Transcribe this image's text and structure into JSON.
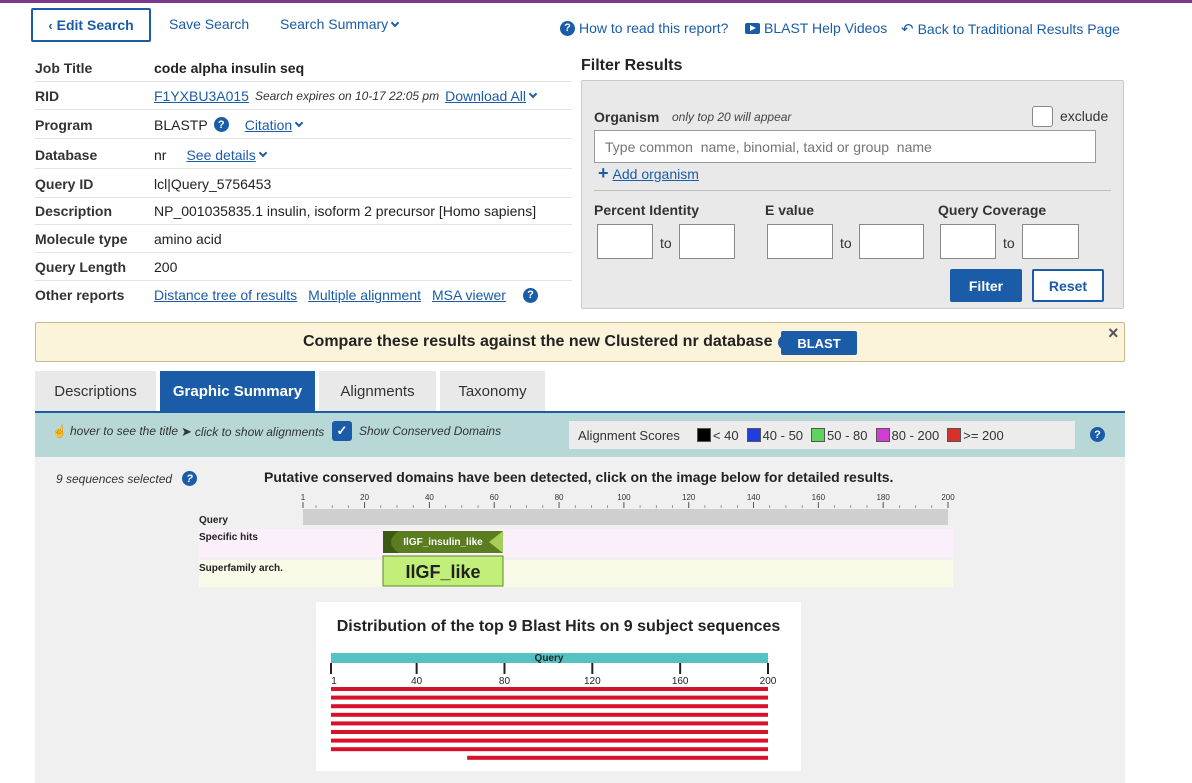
{
  "topbar": {
    "edit_search": "Edit Search",
    "save_search": "Save Search",
    "search_summary": "Search Summary",
    "how_to_read": "How to read this report?",
    "help_videos": "BLAST Help Videos",
    "back_link": "Back to Traditional Results Page"
  },
  "job": {
    "rows": [
      {
        "label": "Job Title",
        "value": "code alpha insulin seq"
      },
      {
        "label": "RID",
        "value": "F1YXBU3A015",
        "expires": "Search expires on 10-17 22:05 pm",
        "download": "Download All"
      },
      {
        "label": "Program",
        "value": "BLASTP",
        "citation": "Citation"
      },
      {
        "label": "Database",
        "value": "nr",
        "see_details": "See details"
      },
      {
        "label": "Query ID",
        "value": "lcl|Query_5756453"
      },
      {
        "label": "Description",
        "value": "NP_001035835.1 insulin, isoform 2 precursor [Homo sapiens]"
      },
      {
        "label": "Molecule type",
        "value": "amino acid"
      },
      {
        "label": "Query Length",
        "value": "200"
      },
      {
        "label": "Other reports",
        "links": [
          "Distance tree of results",
          "Multiple alignment",
          "MSA viewer"
        ]
      }
    ]
  },
  "filter": {
    "title": "Filter Results",
    "organism_label": "Organism",
    "organism_hint": "only top 20 will appear",
    "exclude_label": "exclude",
    "organism_placeholder": "Type common  name, binomial, taxid or group  name",
    "add_organism": "Add organism",
    "percent_identity": "Percent Identity",
    "e_value": "E value",
    "query_coverage": "Query Coverage",
    "to": "to",
    "filter_button": "Filter",
    "reset_button": "Reset"
  },
  "banner": {
    "text": "Compare these results against the new Clustered nr database",
    "button": "BLAST",
    "close": "×"
  },
  "tabs": [
    "Descriptions",
    "Graphic Summary",
    "Alignments",
    "Taxonomy"
  ],
  "active_tab": "Graphic Summary",
  "toolbar": {
    "hover_text": "hover to see the title",
    "click_text": "click to show alignments",
    "show_domains": "Show Conserved Domains",
    "scores_label": "Alignment Scores",
    "score_ranges": [
      {
        "label": "< 40",
        "color": "#000000"
      },
      {
        "label": "40 - 50",
        "color": "#1f3ee0"
      },
      {
        "label": "50 - 80",
        "color": "#5ed45e"
      },
      {
        "label": "80 - 200",
        "color": "#d13ed6"
      },
      {
        "label": ">= 200",
        "color": "#d8302c"
      }
    ]
  },
  "graphic": {
    "sequences_selected": "9 sequences selected",
    "putative_text": "Putative conserved domains have been detected, click on the image below for detailed results.",
    "domain_ticks": [
      "1",
      "20",
      "40",
      "60",
      "80",
      "100",
      "120",
      "140",
      "160",
      "180",
      "200"
    ],
    "query_label": "Query",
    "specific_hits_label": "Specific hits",
    "superfamily_label": "Superfamily arch.",
    "specific_hit": "IlGF_insulin_like",
    "superfamily_hit": "IlGF_like",
    "distribution_title": "Distribution of the top 9 Blast Hits on 9 subject sequences",
    "dist_query_label": "Query",
    "dist_ticks": [
      "1",
      "40",
      "80",
      "120",
      "160",
      "200"
    ],
    "hit_color": "#d8102a",
    "hits": [
      {
        "start": 1,
        "end": 200
      },
      {
        "start": 1,
        "end": 200
      },
      {
        "start": 1,
        "end": 200
      },
      {
        "start": 1,
        "end": 200
      },
      {
        "start": 1,
        "end": 200
      },
      {
        "start": 1,
        "end": 200
      },
      {
        "start": 1,
        "end": 200
      },
      {
        "start": 1,
        "end": 200
      },
      {
        "start": 63,
        "end": 200
      }
    ]
  }
}
